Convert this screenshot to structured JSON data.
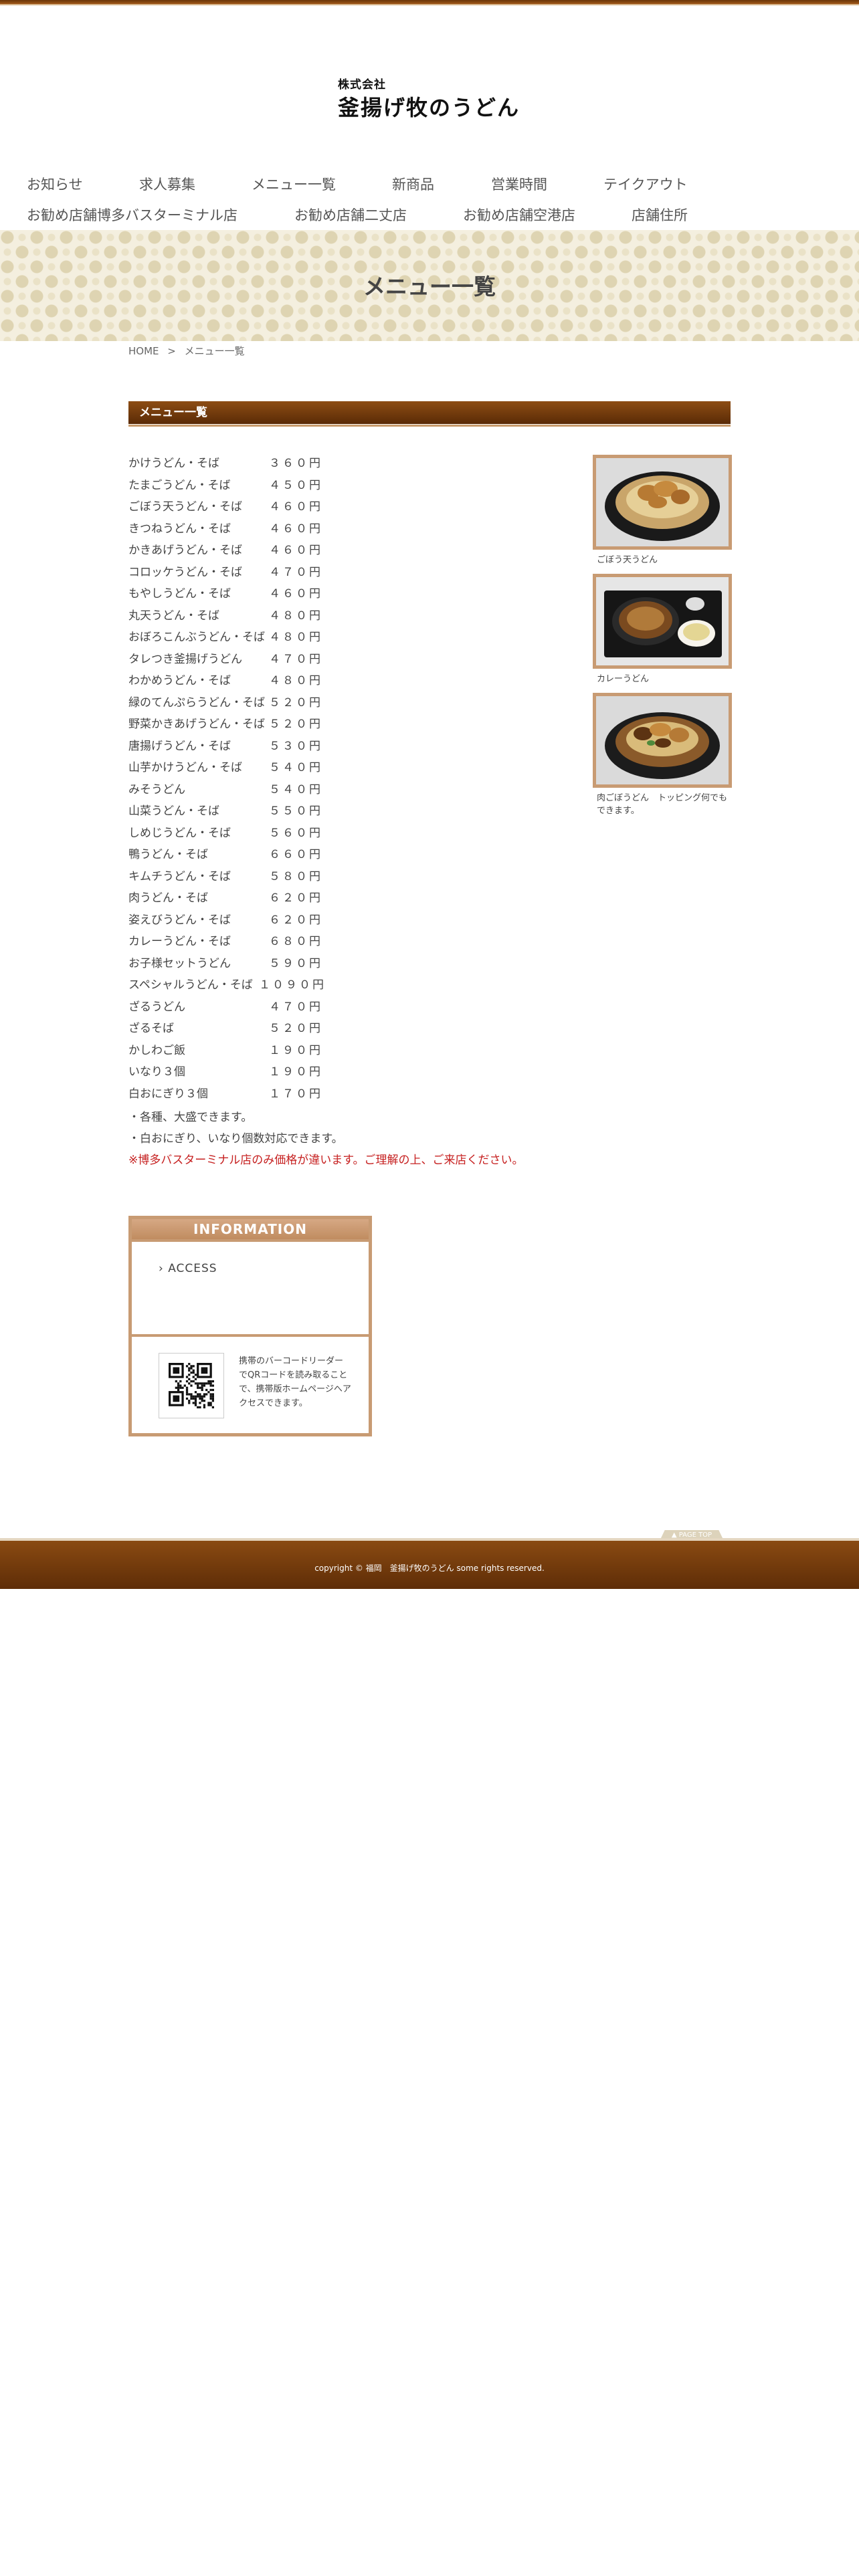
{
  "header": {
    "logo_small": "株式会社",
    "logo_main": "釜揚げ牧のうどん"
  },
  "nav_row1": [
    "お知らせ",
    "求人募集",
    "メニュー一覧",
    "新商品",
    "営業時間",
    "テイクアウト"
  ],
  "nav_row2": [
    "お勧め店舗博多バスターミナル店",
    "お勧め店舗二丈店",
    "お勧め店舗空港店",
    "店舗住所"
  ],
  "hero": {
    "title": "メニュー一覧"
  },
  "breadcrumb": {
    "home": "HOME",
    "sep": ">",
    "current": "メニュー一覧"
  },
  "section": {
    "title": "メニュー一覧"
  },
  "menu_items": [
    {
      "name": "かけうどん・そば",
      "price": "３６０円"
    },
    {
      "name": "たまごうどん・そば",
      "price": "４５０円"
    },
    {
      "name": "ごぼう天うどん・そば",
      "price": "４６０円"
    },
    {
      "name": "きつねうどん・そば",
      "price": "４６０円"
    },
    {
      "name": "かきあげうどん・そば",
      "price": "４６０円"
    },
    {
      "name": "コロッケうどん・そば",
      "price": "４７０円"
    },
    {
      "name": "もやしうどん・そば",
      "price": "４６０円"
    },
    {
      "name": "丸天うどん・そば",
      "price": "４８０円"
    },
    {
      "name": "おぼろこんぶうどん・そば",
      "price": "４８０円"
    },
    {
      "name": "タレつき釜揚げうどん",
      "price": "４７０円"
    },
    {
      "name": "わかめうどん・そば",
      "price": "４８０円"
    },
    {
      "name": "緑のてんぷらうどん・そば",
      "price": "５２０円"
    },
    {
      "name": "野菜かきあげうどん・そば",
      "price": "５２０円"
    },
    {
      "name": "唐揚げうどん・そば",
      "price": "５３０円"
    },
    {
      "name": "山芋かけうどん・そば",
      "price": "５４０円"
    },
    {
      "name": "みそうどん",
      "price": "５４０円"
    },
    {
      "name": "山菜うどん・そば",
      "price": "５５０円"
    },
    {
      "name": "しめじうどん・そば",
      "price": "５６０円"
    },
    {
      "name": "鴨うどん・そば",
      "price": "６６０円"
    },
    {
      "name": "キムチうどん・そば",
      "price": "５８０円"
    },
    {
      "name": "肉うどん・そば",
      "price": "６２０円"
    },
    {
      "name": "姿えびうどん・そば",
      "price": "６２０円"
    },
    {
      "name": "カレーうどん・そば",
      "price": "６８０円"
    },
    {
      "name": "お子様セットうどん",
      "price": "５９０円"
    },
    {
      "name": "スペシャルうどん・そば",
      "price": "１０９０円"
    },
    {
      "name": "ざるうどん",
      "price": "４７０円"
    },
    {
      "name": "ざるそば",
      "price": "５２０円"
    },
    {
      "name": "かしわご飯",
      "price": "１９０円"
    },
    {
      "name": "いなり３個",
      "price": "１９０円"
    },
    {
      "name": "白おにぎり３個",
      "price": "１７０円"
    }
  ],
  "notes": [
    "・各種、大盛できます。",
    "・白おにぎり、いなり個数対応できます。"
  ],
  "note_red": "※博多バスターミナル店のみ価格が違います。ご理解の上、ご来店ください。",
  "photos": [
    {
      "caption": "ごぼう天うどん"
    },
    {
      "caption": "カレーうどん"
    },
    {
      "caption": "肉ごぼうどん　トッピング何でもできます。"
    }
  ],
  "info": {
    "title": "INFORMATION",
    "access": "› ACCESS",
    "qr_text": "携帯のバーコードリーダーでQRコードを読み取ることで、携帯版ホームページへアクセスできます。"
  },
  "pagetop": "▲ PAGE TOP",
  "footer": {
    "copyright": "copyright © 福岡　釜揚げ牧のうどん some rights reserved."
  }
}
